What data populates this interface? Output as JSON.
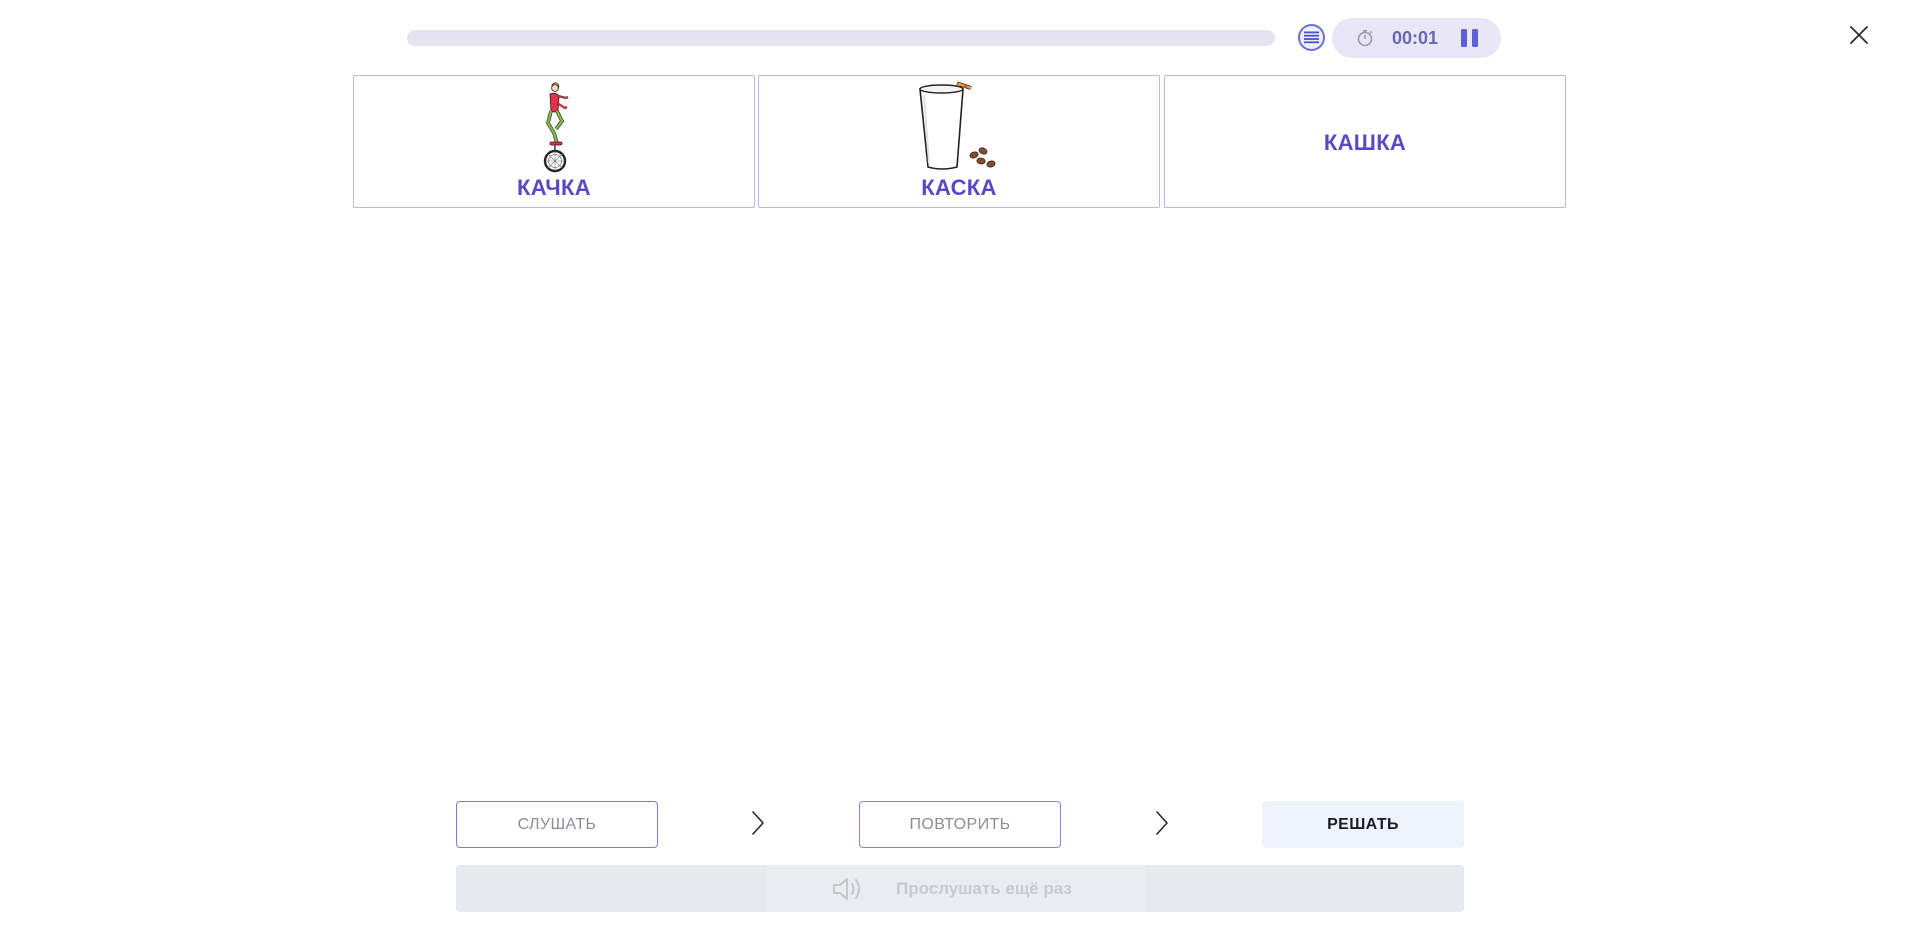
{
  "topbar": {
    "progress_percent": 0,
    "timer": "00:01",
    "icons": {
      "list": "list-icon",
      "timer": "stopwatch-icon",
      "pause": "pause-icon",
      "close": "close-icon"
    }
  },
  "cards": [
    {
      "word": "КАЧКА",
      "picture": "unicycle-rider-picture"
    },
    {
      "word": "КАСКА",
      "picture": "milk-glass-with-straw-picture"
    },
    {
      "word": "КАШКА",
      "picture": null
    }
  ],
  "steps": {
    "listen_label": "СЛУШАТЬ",
    "repeat_label": "ПОВТОРИТЬ",
    "solve_label": "РЕШАТЬ"
  },
  "replay": {
    "label": "Прослушать ещё раз",
    "icon": "speaker-icon"
  },
  "colors": {
    "accent": "#5b48c7",
    "card_border": "#bdb6ec",
    "solve_bg": "#eff4fc",
    "disabled_bg": "#e6e9ee"
  }
}
